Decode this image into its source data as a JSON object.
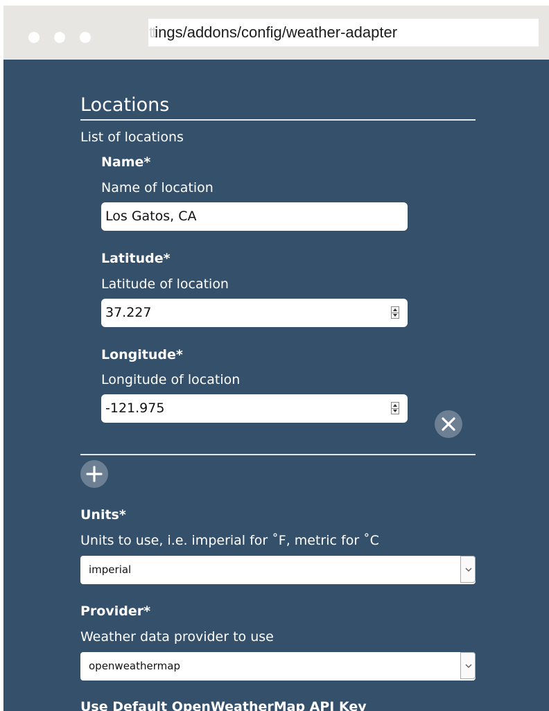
{
  "browser": {
    "address_faded": "tt",
    "address_visible": "ings/addons/config/weather-adapter"
  },
  "locations": {
    "title": "Locations",
    "description": "List of locations",
    "name": {
      "label": "Name*",
      "description": "Name of location",
      "value": "Los Gatos, CA"
    },
    "latitude": {
      "label": "Latitude*",
      "description": "Latitude of location",
      "value": "37.227"
    },
    "longitude": {
      "label": "Longitude*",
      "description": "Longitude of location",
      "value": "-121.975"
    }
  },
  "units": {
    "label": "Units*",
    "description": "Units to use, i.e. imperial for ˚F, metric for ˚C",
    "selected": "imperial"
  },
  "provider": {
    "label": "Provider*",
    "description": "Weather data provider to use",
    "selected": "openweathermap"
  },
  "api_key": {
    "label": "Use Default OpenWeatherMap API Key"
  },
  "colors": {
    "page_background": "#34506a",
    "titlebar": "#e8e6e3",
    "round_button": "#6d8093"
  }
}
